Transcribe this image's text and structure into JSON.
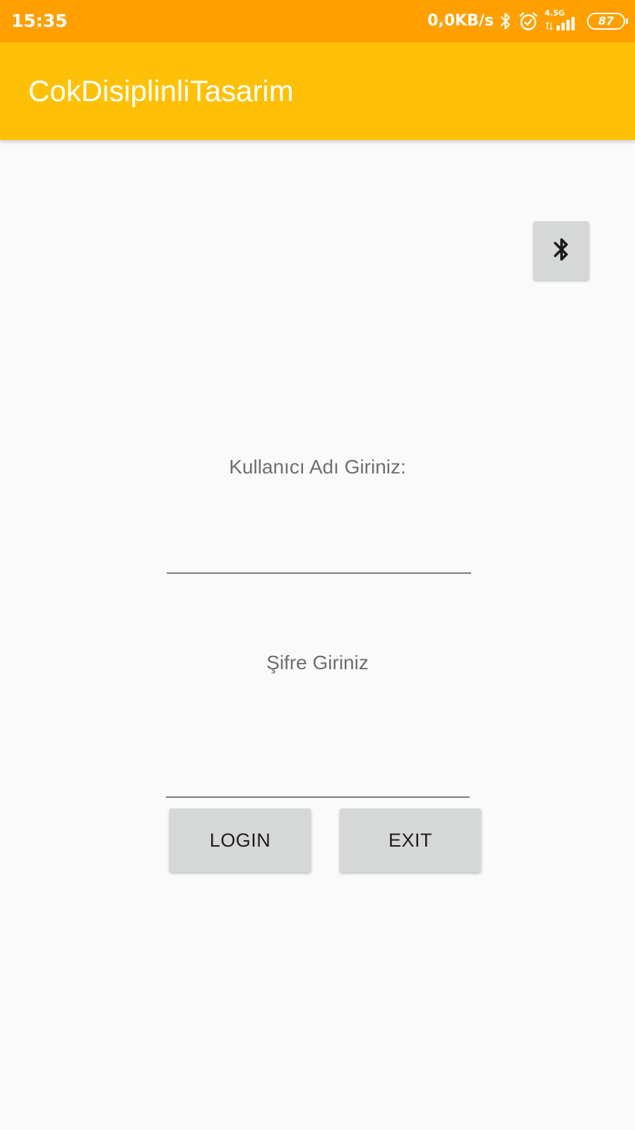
{
  "status_bar": {
    "time": "15:35",
    "net_speed": "0,0KB/s",
    "network_type": "4.5G",
    "battery_level": "87",
    "icons": [
      "bluetooth-icon",
      "alarm-icon",
      "signal-icon",
      "battery-icon"
    ]
  },
  "app_bar": {
    "title": "CokDisiplinliTasarim",
    "background_color": "#ffc107",
    "status_bar_color": "#ffa000"
  },
  "bluetooth_button": {
    "icon": "bluetooth-icon"
  },
  "form": {
    "username_label": "Kullanıcı Adı Giriniz:",
    "username_value": "",
    "password_label": "Şifre Giriniz",
    "password_value": ""
  },
  "actions": {
    "login_label": "LOGIN",
    "exit_label": "EXIT"
  }
}
